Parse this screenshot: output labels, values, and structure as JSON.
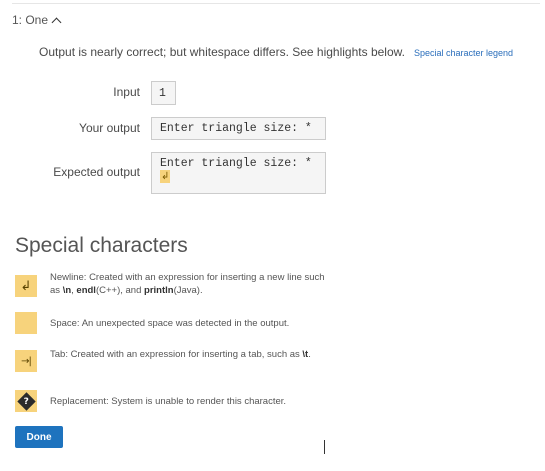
{
  "test": {
    "header_label": "1: One",
    "result_message": "Output is nearly correct; but whitespace differs. See highlights below.",
    "legend_link": "Special character legend"
  },
  "rows": {
    "input_label": "Input",
    "input_value": "1",
    "your_output_label": "Your output",
    "your_output_value": "Enter triangle size: *",
    "expected_output_label": "Expected output",
    "expected_output_value": "Enter triangle size: *"
  },
  "special": {
    "title": "Special characters",
    "newline_symbol": "↲",
    "newline_prefix": "Newline: Created with an expression for inserting a new line such as ",
    "newline_code1": "\\n",
    "newline_sep1": ", ",
    "newline_code2": "endl",
    "newline_mid": "(C++), and ",
    "newline_code3": "println",
    "newline_suffix": "(Java).",
    "space_text": "Space: An unexpected space was detected in the output.",
    "tab_symbol": "→|",
    "tab_prefix": "Tab: Created with an expression for inserting a tab, such as ",
    "tab_code": "\\t",
    "tab_suffix": ".",
    "replace_symbol": "?",
    "replace_text": "Replacement: System is unable to render this character."
  },
  "actions": {
    "done_label": "Done"
  },
  "colors": {
    "highlight": "#f7d37c",
    "button": "#1e73be",
    "link": "#2a6ebb"
  }
}
